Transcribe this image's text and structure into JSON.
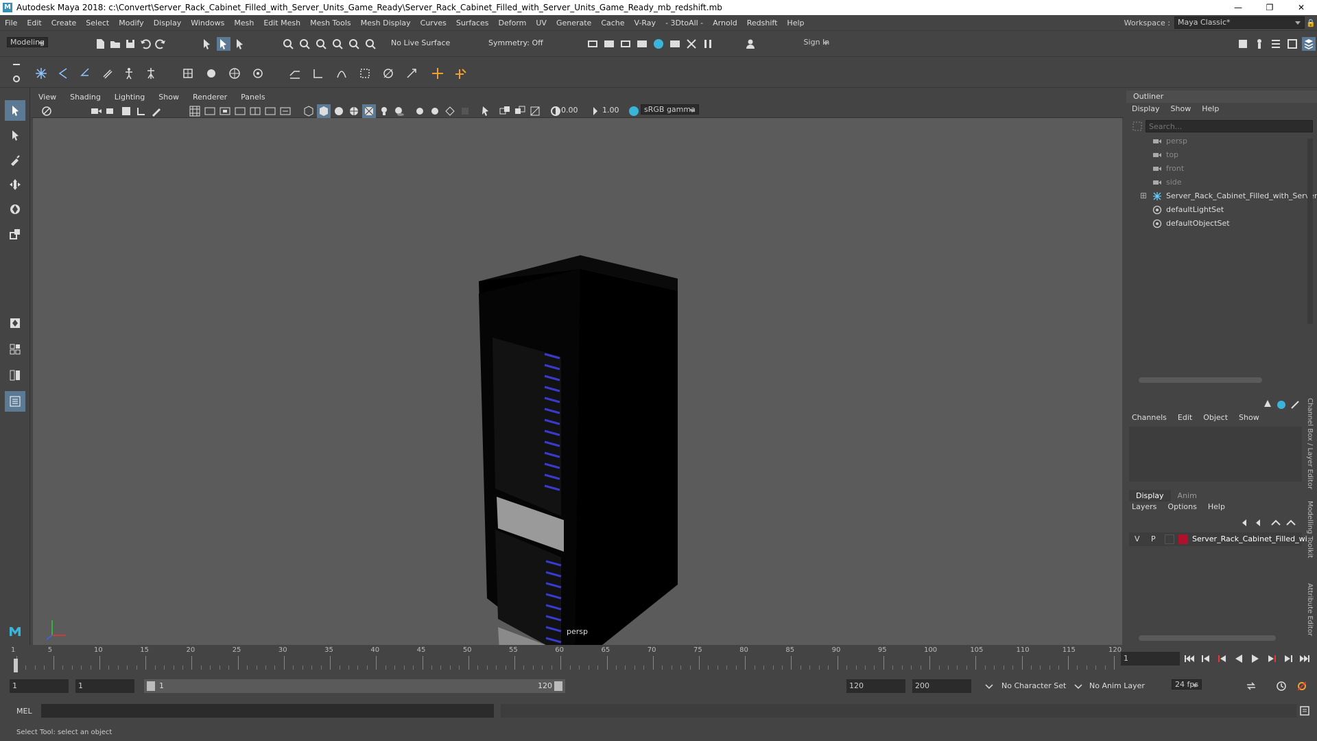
{
  "window": {
    "title": "Autodesk Maya 2018: c:\\Convert\\Server_Rack_Cabinet_Filled_with_Server_Units_Game_Ready\\Server_Rack_Cabinet_Filled_with_Server_Units_Game_Ready_mb_redshift.mb",
    "logo": "M",
    "minimize": "—",
    "maximize": "❐",
    "close": "✕"
  },
  "menubar": {
    "items": [
      "File",
      "Edit",
      "Create",
      "Select",
      "Modify",
      "Display",
      "Windows",
      "Mesh",
      "Edit Mesh",
      "Mesh Tools",
      "Mesh Display",
      "Curves",
      "Surfaces",
      "Deform",
      "UV",
      "Generate",
      "Cache",
      "V-Ray",
      "- 3DtoAll -",
      "Arnold",
      "Redshift",
      "Help"
    ],
    "workspace_label": "Workspace :",
    "workspace_value": "Maya Classic*"
  },
  "statusline": {
    "mode": "Modeling",
    "live_surface": "No Live Surface",
    "symmetry": "Symmetry: Off",
    "sign_in": "Sign In"
  },
  "viewport": {
    "menu": [
      "View",
      "Shading",
      "Lighting",
      "Show",
      "Renderer",
      "Panels"
    ],
    "exposure": "0.00",
    "gamma": "1.00",
    "colorspace": "sRGB gamma",
    "camera_label": "persp"
  },
  "outliner": {
    "title": "Outliner",
    "menu": [
      "Display",
      "Show",
      "Help"
    ],
    "search_placeholder": "Search...",
    "items": [
      {
        "label": "persp",
        "kind": "camera"
      },
      {
        "label": "top",
        "kind": "camera"
      },
      {
        "label": "front",
        "kind": "camera"
      },
      {
        "label": "side",
        "kind": "camera"
      },
      {
        "label": "Server_Rack_Cabinet_Filled_with_Server_",
        "kind": "group"
      },
      {
        "label": "defaultLightSet",
        "kind": "set"
      },
      {
        "label": "defaultObjectSet",
        "kind": "set"
      }
    ]
  },
  "channelbox": {
    "menu": [
      "Channels",
      "Edit",
      "Object",
      "Show"
    ],
    "side_tabs": [
      "Channel Box / Layer Editor",
      "Modelling Toolkit",
      "Attribute Editor"
    ]
  },
  "layers": {
    "tabs": [
      "Display",
      "Anim"
    ],
    "menu": [
      "Layers",
      "Options",
      "Help"
    ],
    "row": {
      "v": "V",
      "p": "P",
      "name": "Server_Rack_Cabinet_Filled_wi",
      "color": "#b0102a"
    }
  },
  "timeline": {
    "ticks": [
      "1",
      "5",
      "10",
      "15",
      "20",
      "25",
      "30",
      "35",
      "40",
      "45",
      "50",
      "55",
      "60",
      "65",
      "70",
      "75",
      "80",
      "85",
      "90",
      "95",
      "100",
      "105",
      "110",
      "115",
      "120"
    ],
    "current_frame": "1"
  },
  "range": {
    "start": "1",
    "playback_start": "1",
    "slider_start": "1",
    "slider_end": "120",
    "playback_end": "120",
    "end": "200",
    "character_set": "No Character Set",
    "anim_layer": "No Anim Layer",
    "fps": "24 fps"
  },
  "mel": {
    "label": "MEL"
  },
  "help": {
    "text": "Select Tool: select an object"
  }
}
